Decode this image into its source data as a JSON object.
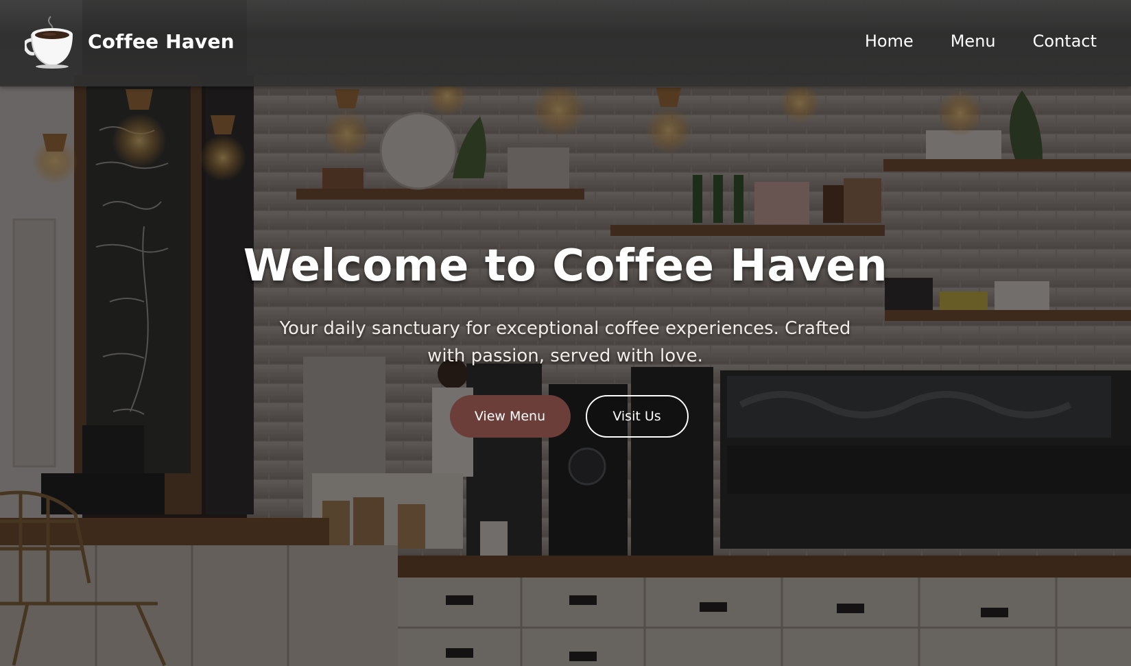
{
  "brand": {
    "name": "Coffee Haven",
    "logo_icon": "coffee-cup-icon"
  },
  "nav": {
    "links": [
      {
        "label": "Home"
      },
      {
        "label": "Menu"
      },
      {
        "label": "Contact"
      }
    ]
  },
  "hero": {
    "title": "Welcome to Coffee Haven",
    "subtitle": "Your daily sanctuary for exceptional coffee experiences. Crafted with passion, served with love.",
    "buttons": {
      "primary_label": "View Menu",
      "secondary_label": "Visit Us"
    }
  },
  "colors": {
    "primary_button": "#6b3e3a",
    "navbar": "#303030",
    "text": "#ffffff"
  }
}
